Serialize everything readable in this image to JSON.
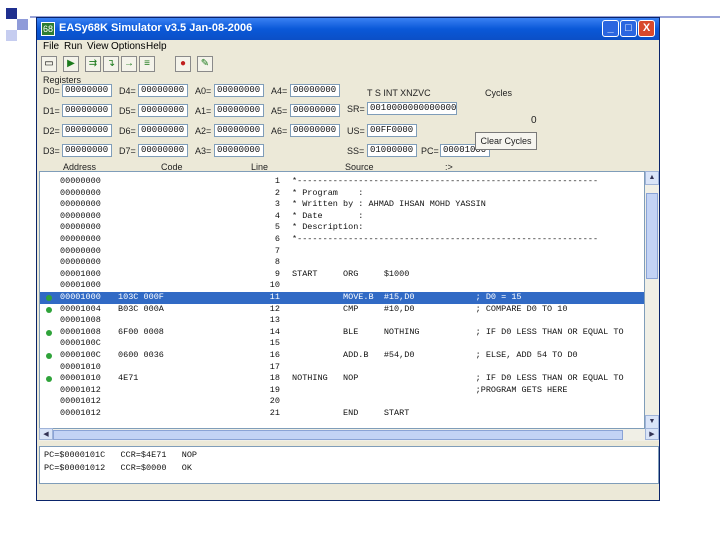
{
  "window": {
    "title": "EASy68K Simulator v3.5 Jan-08-2006",
    "controls": {
      "minimize": "_",
      "maximize": "□",
      "close": "X"
    }
  },
  "menu": [
    "File",
    "Run",
    "View",
    "Options",
    "Help"
  ],
  "toolbar": {
    "icons": [
      "open-icon",
      "run-icon",
      "step-over-icon",
      "trace-into-icon",
      "run-to-cursor-icon",
      "auto-trace-icon",
      "stop-icon",
      "log-icon"
    ]
  },
  "registers": {
    "header": "Registers",
    "data": [
      {
        "label": "D0=",
        "value": "00000000"
      },
      {
        "label": "D1=",
        "value": "00000000"
      },
      {
        "label": "D2=",
        "value": "00000000"
      },
      {
        "label": "D3=",
        "value": "00000000"
      },
      {
        "label": "D4=",
        "value": "00000000"
      },
      {
        "label": "D5=",
        "value": "00000000"
      },
      {
        "label": "D6=",
        "value": "00000000"
      },
      {
        "label": "D7=",
        "value": "00000000"
      }
    ],
    "addr": [
      {
        "label": "A0=",
        "value": "00000000"
      },
      {
        "label": "A1=",
        "value": "00000000"
      },
      {
        "label": "A2=",
        "value": "00000000"
      },
      {
        "label": "A3=",
        "value": "00000000"
      },
      {
        "label": "A4=",
        "value": "00000000"
      },
      {
        "label": "A5=",
        "value": "00000000"
      },
      {
        "label": "A6=",
        "value": "00000000"
      }
    ],
    "flags_header": "T S  INT    XNZVC",
    "sr_label": "SR=",
    "sr_value": "0010000000000000",
    "us_label": "US=",
    "us_value": "00FF0000",
    "ss_label": "SS=",
    "ss_value": "01000000",
    "pc_label": "PC=",
    "pc_value": "00001000"
  },
  "cycles": {
    "label": "Cycles",
    "value": "0",
    "clear_label": "Clear Cycles"
  },
  "columns": {
    "address": "Address",
    "code": "Code",
    "line": "Line",
    "source": "Source",
    "arrow": ":>"
  },
  "listing": [
    {
      "addr": "00000000",
      "code": "",
      "line": "1",
      "src": "*-----------------------------------------------------------",
      "bp": false,
      "sel": false
    },
    {
      "addr": "00000000",
      "code": "",
      "line": "2",
      "src": "* Program    :",
      "bp": false,
      "sel": false
    },
    {
      "addr": "00000000",
      "code": "",
      "line": "3",
      "src": "* Written by : AHMAD IHSAN MOHD YASSIN",
      "bp": false,
      "sel": false
    },
    {
      "addr": "00000000",
      "code": "",
      "line": "4",
      "src": "* Date       :",
      "bp": false,
      "sel": false
    },
    {
      "addr": "00000000",
      "code": "",
      "line": "5",
      "src": "* Description:",
      "bp": false,
      "sel": false
    },
    {
      "addr": "00000000",
      "code": "",
      "line": "6",
      "src": "*-----------------------------------------------------------",
      "bp": false,
      "sel": false
    },
    {
      "addr": "00000000",
      "code": "",
      "line": "7",
      "src": "",
      "bp": false,
      "sel": false
    },
    {
      "addr": "00000000",
      "code": "",
      "line": "8",
      "src": "",
      "bp": false,
      "sel": false
    },
    {
      "addr": "00001000",
      "code": "",
      "line": "9",
      "src": "START     ORG     $1000",
      "bp": false,
      "sel": false
    },
    {
      "addr": "00001000",
      "code": "",
      "line": "10",
      "src": "",
      "bp": false,
      "sel": false
    },
    {
      "addr": "00001000",
      "code": "103C 000F",
      "line": "11",
      "src": "          MOVE.B  #15,D0            ; D0 = 15",
      "bp": true,
      "sel": true
    },
    {
      "addr": "00001004",
      "code": "B03C 000A",
      "line": "12",
      "src": "          CMP     #10,D0            ; COMPARE D0 TO 10",
      "bp": true,
      "sel": false
    },
    {
      "addr": "00001008",
      "code": "",
      "line": "13",
      "src": "",
      "bp": false,
      "sel": false
    },
    {
      "addr": "00001008",
      "code": "6F00 0008",
      "line": "14",
      "src": "          BLE     NOTHING           ; IF D0 LESS THAN OR EQUAL TO",
      "bp": true,
      "sel": false
    },
    {
      "addr": "0000100C",
      "code": "",
      "line": "15",
      "src": "",
      "bp": false,
      "sel": false
    },
    {
      "addr": "0000100C",
      "code": "0600 0036",
      "line": "16",
      "src": "          ADD.B   #54,D0            ; ELSE, ADD 54 TO D0",
      "bp": true,
      "sel": false
    },
    {
      "addr": "00001010",
      "code": "",
      "line": "17",
      "src": "",
      "bp": false,
      "sel": false
    },
    {
      "addr": "00001010",
      "code": "4E71",
      "line": "18",
      "src": "NOTHING   NOP                       ; IF D0 LESS THAN OR EQUAL TO",
      "bp": true,
      "sel": false
    },
    {
      "addr": "00001012",
      "code": "",
      "line": "19",
      "src": "                                    ;PROGRAM GETS HERE",
      "bp": false,
      "sel": false
    },
    {
      "addr": "00001012",
      "code": "",
      "line": "20",
      "src": "",
      "bp": false,
      "sel": false
    },
    {
      "addr": "00001012",
      "code": "",
      "line": "21",
      "src": "          END     START",
      "bp": false,
      "sel": false
    }
  ],
  "status": {
    "line1": "PC=$0000101C   CCR=$4E71   NOP",
    "line2": "PC=$00001012   CCR=$0000   OK"
  }
}
